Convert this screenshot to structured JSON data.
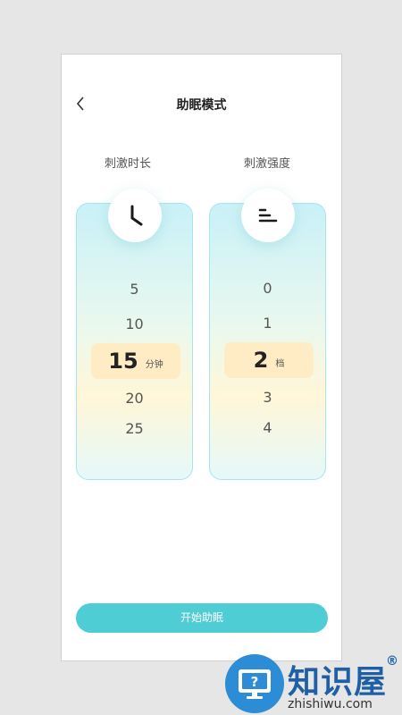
{
  "header": {
    "title": "助眠模式"
  },
  "duration": {
    "label": "刺激时长",
    "values_above": [
      "5",
      "10"
    ],
    "selected": "15",
    "unit": "分钟",
    "values_below": [
      "20",
      "25"
    ],
    "icon": "clock-icon"
  },
  "intensity": {
    "label": "刺激强度",
    "values_above": [
      "0",
      "1"
    ],
    "selected": "2",
    "unit": "档",
    "values_below": [
      "3",
      "4"
    ],
    "icon": "intensity-bars-icon"
  },
  "start_button": {
    "label": "开始助眠"
  },
  "watermark": {
    "title": "知识屋",
    "url": "zhishiwu.com",
    "reg": "®"
  },
  "colors": {
    "accent": "#4fcdd4",
    "selected_bg": "#ffebc4",
    "watermark": "#1f5fa6"
  }
}
